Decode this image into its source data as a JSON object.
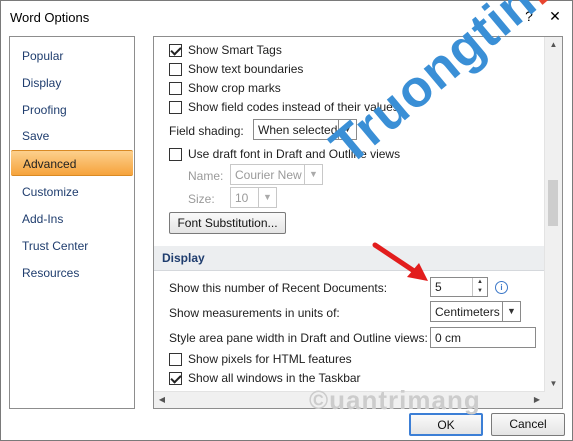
{
  "window": {
    "title": "Word Options",
    "help_glyph": "?",
    "close_glyph": "✕"
  },
  "sidebar": {
    "items": [
      {
        "label": "Popular"
      },
      {
        "label": "Display"
      },
      {
        "label": "Proofing"
      },
      {
        "label": "Save"
      },
      {
        "label": "Advanced",
        "selected": true
      },
      {
        "label": "Customize"
      },
      {
        "label": "Add-Ins"
      },
      {
        "label": "Trust Center"
      },
      {
        "label": "Resources"
      }
    ]
  },
  "options": {
    "show_smart_tags": {
      "label": "Show Smart Tags",
      "checked": true
    },
    "show_text_boundaries": {
      "label": "Show text boundaries",
      "checked": false
    },
    "show_crop_marks": {
      "label": "Show crop marks",
      "checked": false
    },
    "show_field_codes": {
      "label": "Show field codes instead of their values",
      "checked": false
    },
    "field_shading": {
      "label": "Field shading:",
      "value": "When selected"
    },
    "use_draft_font": {
      "label": "Use draft font in Draft and Outline views",
      "checked": false
    },
    "font_name": {
      "label": "Name:",
      "value": "Courier New"
    },
    "font_size": {
      "label": "Size:",
      "value": "10"
    },
    "font_substitution_button": "Font Substitution..."
  },
  "display_section": {
    "header": "Display",
    "recent_docs": {
      "label": "Show this number of Recent Documents:",
      "value": "5"
    },
    "measurements": {
      "label": "Show measurements in units of:",
      "value": "Centimeters"
    },
    "style_area": {
      "label": "Style area pane width in Draft and Outline views:",
      "value": "0 cm"
    },
    "show_pixels": {
      "label": "Show pixels for HTML features",
      "checked": false
    },
    "show_all_windows": {
      "label": "Show all windows in the Taskbar",
      "checked": true
    }
  },
  "footer": {
    "ok_label": "OK",
    "cancel_label": "Cancel"
  },
  "watermark": {
    "main_text": "Truongtin.top",
    "footer_text": "©uantrimang"
  },
  "colors": {
    "accent_orange": "#f6a33c",
    "link_blue": "#1f3d6e",
    "arrow_red": "#e21d1d",
    "watermark_blue": "#3a8fd6",
    "watermark_red": "#e8452f"
  }
}
